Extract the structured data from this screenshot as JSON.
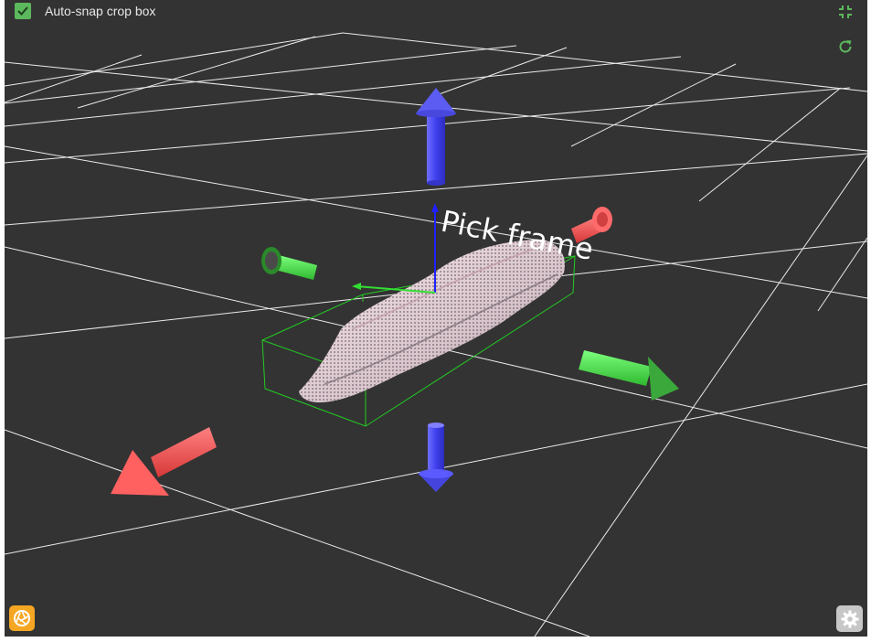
{
  "toolbar": {
    "auto_snap_label": "Auto-snap crop box",
    "auto_snap_checked": true,
    "collapse_icon": "collapse-icon",
    "reset_view_icon": "refresh-icon"
  },
  "scene": {
    "frame_label": "Pick frame",
    "colors": {
      "background": "#333333",
      "grid": "#ffffff",
      "crop_box": "#22cc22",
      "x_axis": "#ff5a5a",
      "y_axis": "#4ddf4d",
      "z_axis": "#5a5aff",
      "point_cloud": "#f2dde3"
    }
  },
  "footer": {
    "capture_icon": "camera-shutter-icon",
    "settings_icon": "gear-icon",
    "capture_color": "#f5a623"
  }
}
